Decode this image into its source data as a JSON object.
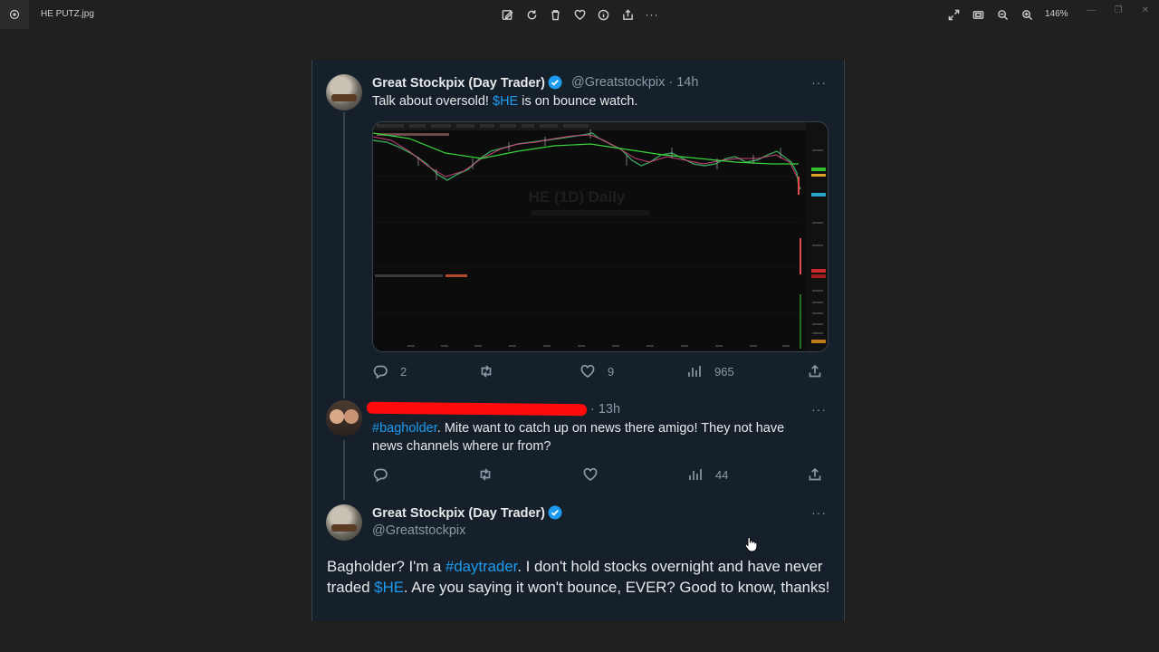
{
  "viewer": {
    "filename": "HE PUTZ.jpg",
    "zoom": "146%",
    "toolbar_icons": [
      "edit-icon",
      "rotate-icon",
      "delete-icon",
      "favorite-icon",
      "info-icon",
      "share-icon",
      "more-icon"
    ],
    "right_icons": [
      "fullscreen-icon",
      "fit-icon",
      "zoom-out-icon",
      "zoom-in-icon"
    ]
  },
  "tweet1": {
    "name": "Great Stockpix (Day Trader)",
    "handle_time": "@Greatstockpix · 14h",
    "text_before": "Talk about oversold! ",
    "ticker": "$HE",
    "text_after": " is on bounce watch.",
    "chart_watermark": "HE (1D) Daily",
    "stats": {
      "replies": "2",
      "retweets": "",
      "likes": "9",
      "views": "965"
    }
  },
  "tweet2": {
    "time": "· 13h",
    "hashtag": "#bagholder",
    "text": ". Mite want to catch up on news there amigo! They not have news channels where ur from?",
    "stats": {
      "replies": "",
      "retweets": "",
      "likes": "",
      "views": "44"
    }
  },
  "tweet3": {
    "name": "Great Stockpix (Day Trader)",
    "handle": "@Greatstockpix",
    "t1": "Bagholder? I'm a ",
    "hashtag": "#daytrader",
    "t2": ". I don't hold stocks overnight and have never traded ",
    "ticker": "$HE",
    "t3": ". Are you saying it won't bounce, EVER? Good to know, thanks!"
  },
  "colors": {
    "accent": "#1d9bf0",
    "panel": "#15202b",
    "muted": "#8b98a5",
    "redaction": "#ff0b0b"
  }
}
